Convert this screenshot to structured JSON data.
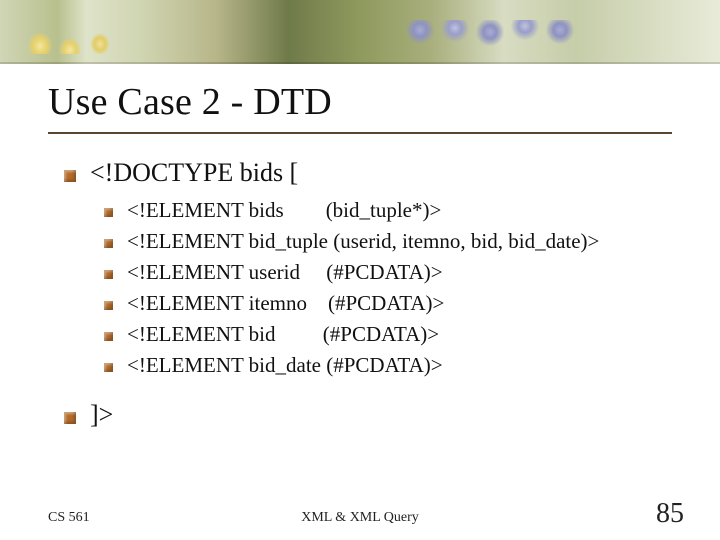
{
  "title": "Use Case 2 - DTD",
  "opening": "<!DOCTYPE bids [",
  "elements": [
    "<!ELEMENT bids        (bid_tuple*)>",
    "<!ELEMENT bid_tuple (userid, itemno, bid, bid_date)>",
    "<!ELEMENT userid     (#PCDATA)>",
    "<!ELEMENT itemno    (#PCDATA)>",
    "<!ELEMENT bid         (#PCDATA)>",
    "<!ELEMENT bid_date (#PCDATA)>"
  ],
  "closing": "]>",
  "footer": {
    "left": "CS 561",
    "center": "XML & XML Query",
    "page": "85"
  }
}
